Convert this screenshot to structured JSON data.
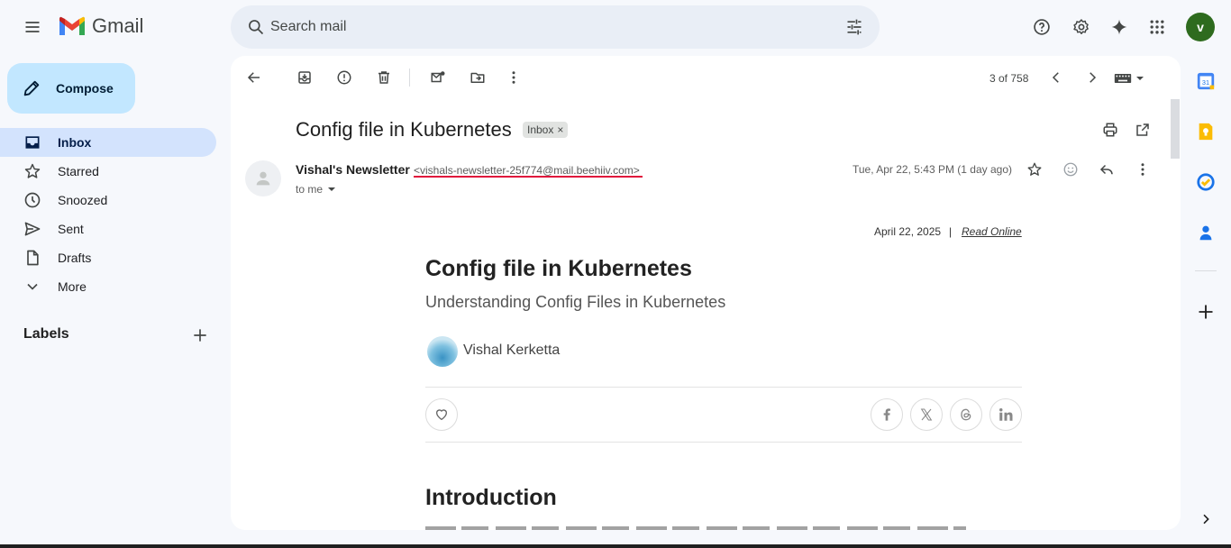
{
  "header": {
    "app_name": "Gmail",
    "search_placeholder": "Search mail",
    "avatar_letter": "v"
  },
  "sidebar": {
    "compose_label": "Compose",
    "items": [
      {
        "label": "Inbox",
        "icon": "inbox-icon",
        "active": true
      },
      {
        "label": "Starred",
        "icon": "star-icon"
      },
      {
        "label": "Snoozed",
        "icon": "clock-icon"
      },
      {
        "label": "Sent",
        "icon": "send-icon"
      },
      {
        "label": "Drafts",
        "icon": "draft-icon"
      },
      {
        "label": "More",
        "icon": "chevron-down-icon"
      }
    ],
    "labels_title": "Labels"
  },
  "toolbar": {
    "pagination": "3 of 758"
  },
  "email": {
    "subject": "Config file in Kubernetes",
    "label_chip": "Inbox",
    "sender_name": "Vishal's Newsletter",
    "sender_email": "<vishals-newsletter-25f774@mail.beehiiv.com>",
    "recipient": "to me",
    "date": "Tue, Apr 22, 5:43 PM (1 day ago)"
  },
  "newsletter": {
    "date": "April 22, 2025",
    "separator": "|",
    "read_online": "Read Online",
    "title": "Config file in Kubernetes",
    "subtitle": "Understanding Config Files in Kubernetes",
    "author": "Vishal Kerketta",
    "section_heading": "Introduction"
  },
  "colors": {
    "compose_bg": "#c2e7ff",
    "active_nav_bg": "#d3e3fd",
    "avatar_bg": "#2e6b1e",
    "email_underline": "#e0143c"
  }
}
